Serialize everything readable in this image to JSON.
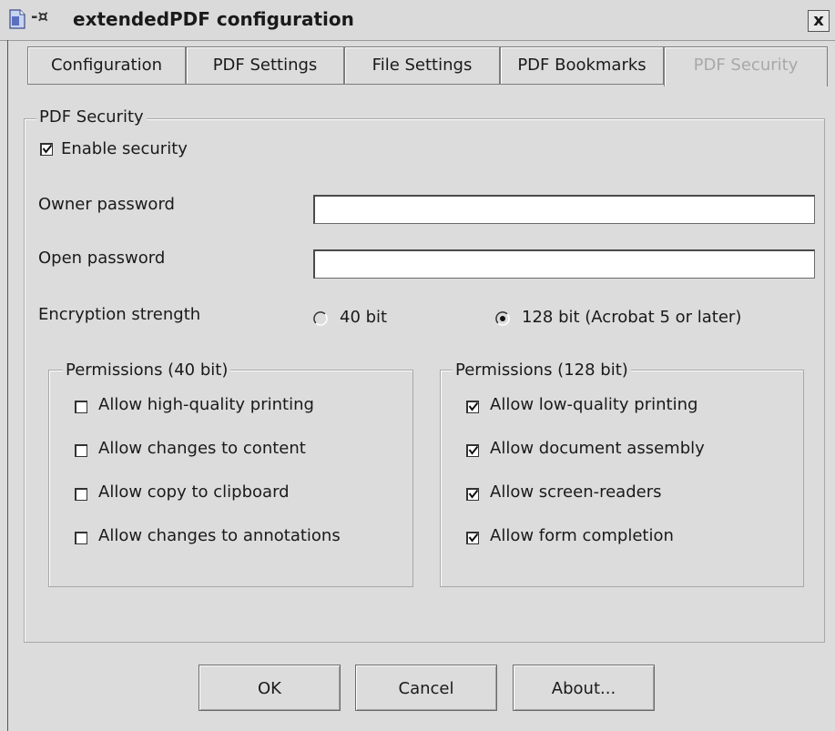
{
  "window": {
    "title": "extendedPDF configuration",
    "pin_glyph": "-¤",
    "close_glyph": "x"
  },
  "tabs": [
    {
      "label": "Configuration",
      "disabled": false
    },
    {
      "label": "PDF Settings",
      "disabled": false
    },
    {
      "label": "File Settings",
      "disabled": false
    },
    {
      "label": "PDF Bookmarks",
      "disabled": false
    },
    {
      "label": "PDF Security",
      "disabled": true
    }
  ],
  "security": {
    "group_title": "PDF Security",
    "enable_label": "Enable security",
    "enable_checked": true,
    "owner_password_label": "Owner password",
    "owner_password_value": "",
    "open_password_label": "Open password",
    "open_password_value": "",
    "encryption_label": "Encryption strength",
    "enc_options": [
      {
        "label": "40 bit",
        "selected": false
      },
      {
        "label": "128 bit (Acrobat 5 or later)",
        "selected": true
      }
    ]
  },
  "perm40": {
    "title": "Permissions (40 bit)",
    "items": [
      {
        "label": "Allow high-quality printing",
        "checked": false
      },
      {
        "label": "Allow changes to content",
        "checked": false
      },
      {
        "label": "Allow copy to clipboard",
        "checked": false
      },
      {
        "label": "Allow changes to annotations",
        "checked": false
      }
    ]
  },
  "perm128": {
    "title": "Permissions (128 bit)",
    "items": [
      {
        "label": "Allow low-quality printing",
        "checked": true
      },
      {
        "label": "Allow document assembly",
        "checked": true
      },
      {
        "label": "Allow screen-readers",
        "checked": true
      },
      {
        "label": "Allow form completion",
        "checked": true
      }
    ]
  },
  "buttons": {
    "ok": "OK",
    "cancel": "Cancel",
    "about": "About..."
  },
  "icons": {
    "app": "document-icon",
    "pin": "pin-icon",
    "close": "close-icon",
    "check": "checkmark-icon",
    "radio": "radio-dot-icon"
  }
}
